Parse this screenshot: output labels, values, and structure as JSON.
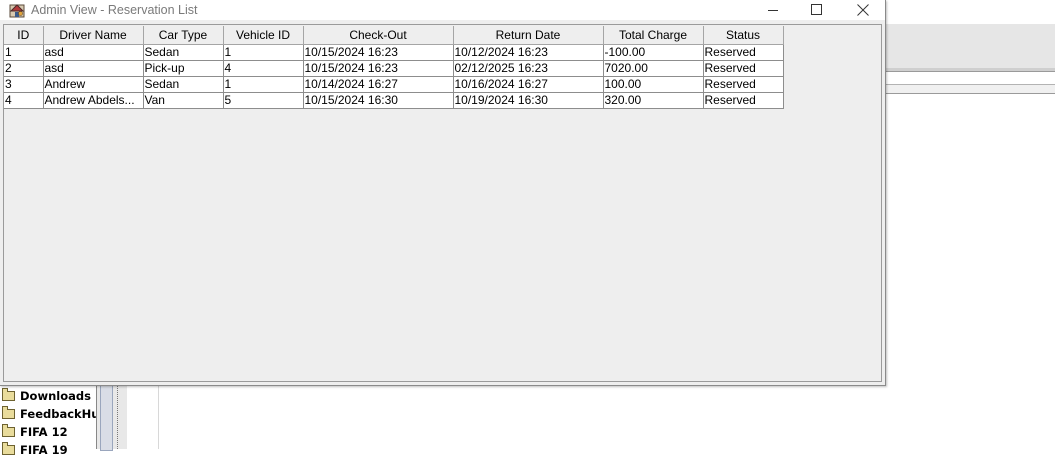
{
  "window": {
    "title": "Admin View - Reservation List"
  },
  "table": {
    "columns": [
      "ID",
      "Driver Name",
      "Car Type",
      "Vehicle ID",
      "Check-Out",
      "Return Date",
      "Total Charge",
      "Status"
    ],
    "rows": [
      [
        "1",
        "asd",
        "Sedan",
        "1",
        "10/15/2024 16:23",
        "10/12/2024 16:23",
        "-100.00",
        "Reserved"
      ],
      [
        "2",
        "asd",
        "Pick-up",
        "4",
        "10/15/2024 16:23",
        "02/12/2025 16:23",
        "7020.00",
        "Reserved"
      ],
      [
        "3",
        "Andrew",
        "Sedan",
        "1",
        "10/14/2024 16:27",
        "10/16/2024 16:27",
        "100.00",
        "Reserved"
      ],
      [
        "4",
        "Andrew Abdels...",
        "Van",
        "5",
        "10/15/2024 16:30",
        "10/19/2024 16:30",
        "320.00",
        "Reserved"
      ]
    ]
  },
  "background_tree": {
    "items": [
      "Downloads",
      "FeedbackHub",
      "FIFA 12",
      "FIFA 19"
    ]
  }
}
